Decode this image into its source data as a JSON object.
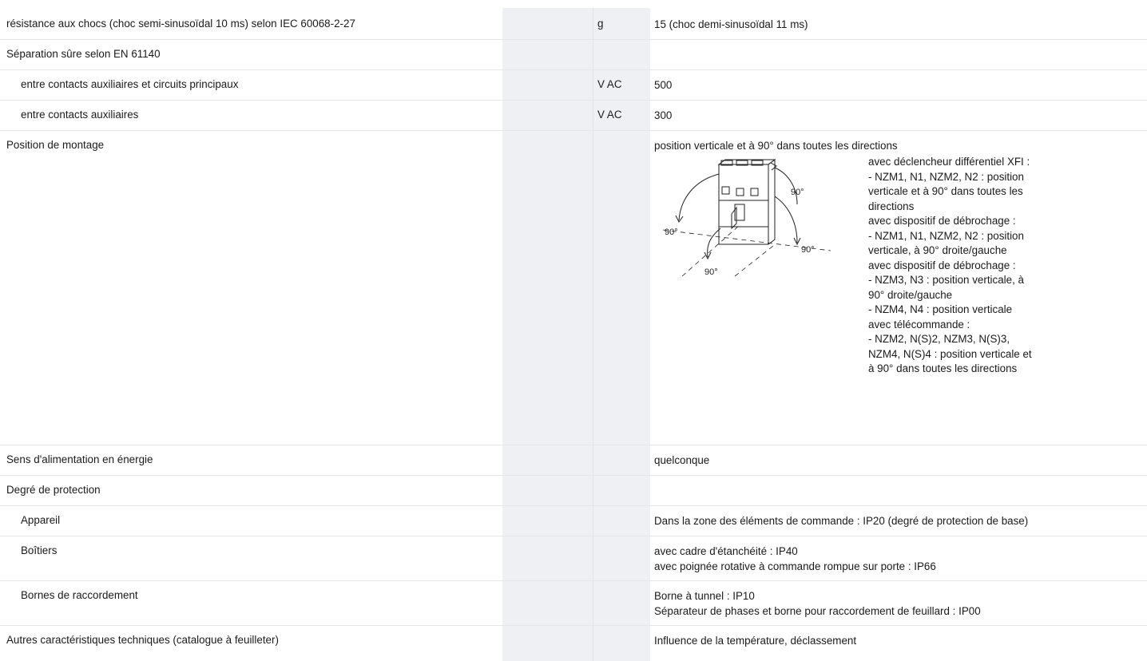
{
  "rows": [
    {
      "label": "résistance aux chocs (choc semi-sinusoïdal 10 ms) selon IEC 60068-2-27",
      "unit": "g",
      "value": "15 (choc demi-sinusoïdal 11 ms)"
    },
    {
      "label": "Séparation sûre selon EN 61140",
      "unit": "",
      "value": ""
    },
    {
      "label": "entre contacts auxiliaires et circuits principaux",
      "unit": "V AC",
      "value": "500"
    },
    {
      "label": "entre contacts auxiliaires",
      "unit": "V AC",
      "value": "300"
    },
    {
      "label": "Position de montage",
      "unit": "",
      "value": "position verticale et à 90° dans toutes les directions"
    },
    {
      "label": "Sens d'alimentation en énergie",
      "unit": "",
      "value": "quelconque"
    },
    {
      "label": "Degré de protection",
      "unit": "",
      "value": ""
    },
    {
      "label": "Appareil",
      "unit": "",
      "value": "Dans la zone des éléments de commande : IP20 (degré de protection de base)"
    },
    {
      "label": "Boîtiers",
      "unit": "",
      "value": "avec cadre d'étanchéité : IP40",
      "value2": "avec poignée rotative à commande rompue sur porte : IP66"
    },
    {
      "label": "Bornes de raccordement",
      "unit": "",
      "value": "Borne à tunnel : IP10",
      "value2": "Séparateur de phases et borne pour raccordement de feuillard : IP00"
    },
    {
      "label": "Autres caractéristiques techniques (catalogue à feuilleter)",
      "unit": "",
      "value": "Influence de la température, déclassement"
    }
  ],
  "mounting_notes": [
    "avec déclencheur différentiel XFI :",
    "- NZM1, N1, NZM2, N2 : position",
    "verticale et à 90° dans toutes les",
    "directions",
    "avec dispositif de débrochage :",
    "- NZM1, N1, NZM2, N2 : position",
    "verticale, à 90° droite/gauche",
    "avec dispositif de débrochage :",
    "- NZM3, N3 : position verticale, à",
    "90° droite/gauche",
    "- NZM4, N4 : position verticale",
    "avec télécommande :",
    "- NZM2, N(S)2, NZM3, N(S)3,",
    "NZM4, N(S)4 : position verticale et",
    "à 90° dans toutes les directions"
  ],
  "diagram_labels": {
    "top_right": "90°",
    "left": "90°",
    "right": "90°",
    "bottom": "90°"
  }
}
